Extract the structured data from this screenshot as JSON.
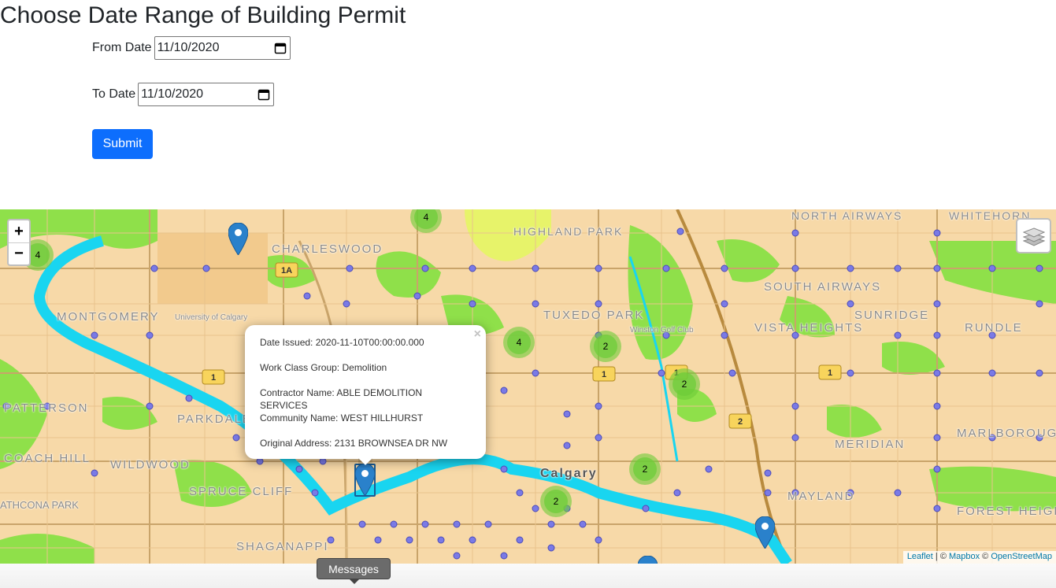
{
  "page": {
    "title": "Choose Date Range of Building Permit"
  },
  "form": {
    "from_label": "From Date",
    "from_value": "11/10/2020",
    "to_label": "To Date",
    "to_value": "11/10/2020",
    "submit_label": "Submit",
    "submit_color": "#0d6efd"
  },
  "map": {
    "zoom_in": "+",
    "zoom_out": "−",
    "layers_icon": "layers-icon",
    "place_labels": [
      "CHARLESWOOD",
      "HIGHLAND PARK",
      "NORTH AIRWAYS",
      "WHITEHORN",
      "MONTGOMERY",
      "University of Calgary",
      "TUXEDO PARK",
      "SOUTH AIRWAYS",
      "SUNRIDGE",
      "RUNDLE",
      "VISTA HEIGHTS",
      "Winston Golf Club",
      "PATTERSON",
      "PARKDALE",
      "WILDWOOD",
      "SPRUCE CLIFF",
      "MERIDIAN",
      "MARLBOROUGH",
      "Calgary",
      "MAYLAND",
      "FOREST HEIGHTS",
      "SHAGANAPPI",
      "COACH HILL",
      "ATHCONA PARK"
    ],
    "route_shields": [
      "1A",
      "1",
      "1",
      "1",
      "1",
      "2"
    ],
    "clusters": [
      "4",
      "4",
      "4",
      "2",
      "2",
      "2",
      "2"
    ],
    "marker_color": "#2a81cb",
    "cluster_color": "#6ecc39",
    "river_color": "#19d5f0",
    "attribution": {
      "leaflet": "Leaflet",
      "sep1": " | © ",
      "mapbox": "Mapbox",
      "sep2": " © ",
      "osm": "OpenStreetMap"
    }
  },
  "popup": {
    "close": "×",
    "date_issued": "Date Issued: 2020-11-10T00:00:00.000",
    "work_class": "Work Class Group: Demolition",
    "contractor": "Contractor Name: ABLE DEMOLITION SERVICES",
    "community": "Community Name: WEST HILLHURST",
    "address": "Original Address: 2131 BROWNSEA DR NW"
  },
  "tooltip": {
    "messages": "Messages"
  }
}
